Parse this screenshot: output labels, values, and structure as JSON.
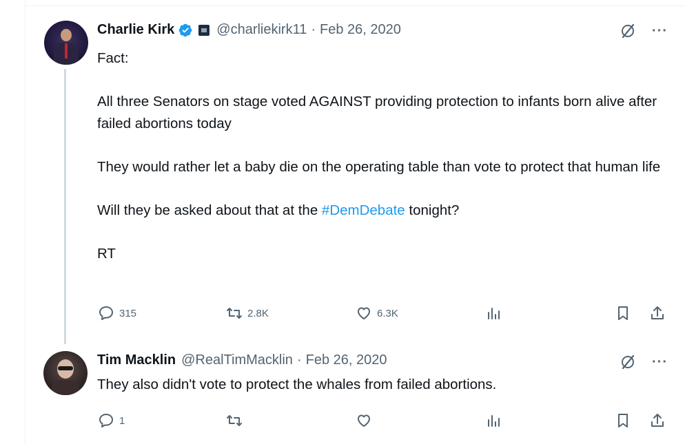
{
  "tweet": {
    "author_name": "Charlie Kirk",
    "author_handle": "@charliekirk11",
    "separator": "·",
    "date": "Feb 26, 2020",
    "text_line1": "Fact:",
    "text_para2": "All three Senators on stage voted AGAINST providing protection to infants born alive after failed abortions today",
    "text_para3": "They would rather let a baby die on the operating table than vote to protect that human life",
    "text_para4_before": "Will they be asked about that at the ",
    "hashtag": "#DemDebate",
    "text_para4_after": " tonight?",
    "text_para5": "RT",
    "replies": "315",
    "retweets": "2.8K",
    "likes": "6.3K"
  },
  "reply": {
    "author_name": "Tim Macklin",
    "author_handle": "@RealTimMacklin",
    "separator": "·",
    "date": "Feb 26, 2020",
    "text": "They also didn't vote to protect the whales from failed abortions.",
    "replies": "1"
  },
  "icons": {
    "verified": "verified-badge-icon",
    "affiliate": "affiliate-badge-icon",
    "grok": "grok-icon",
    "more": "more-icon",
    "reply": "reply-icon",
    "retweet": "retweet-icon",
    "like": "like-icon",
    "views": "views-icon",
    "bookmark": "bookmark-icon",
    "share": "share-icon"
  },
  "colors": {
    "accent": "#1d9bf0",
    "muted": "#536471",
    "text": "#0f1419",
    "thread_line": "#cfd9de"
  }
}
